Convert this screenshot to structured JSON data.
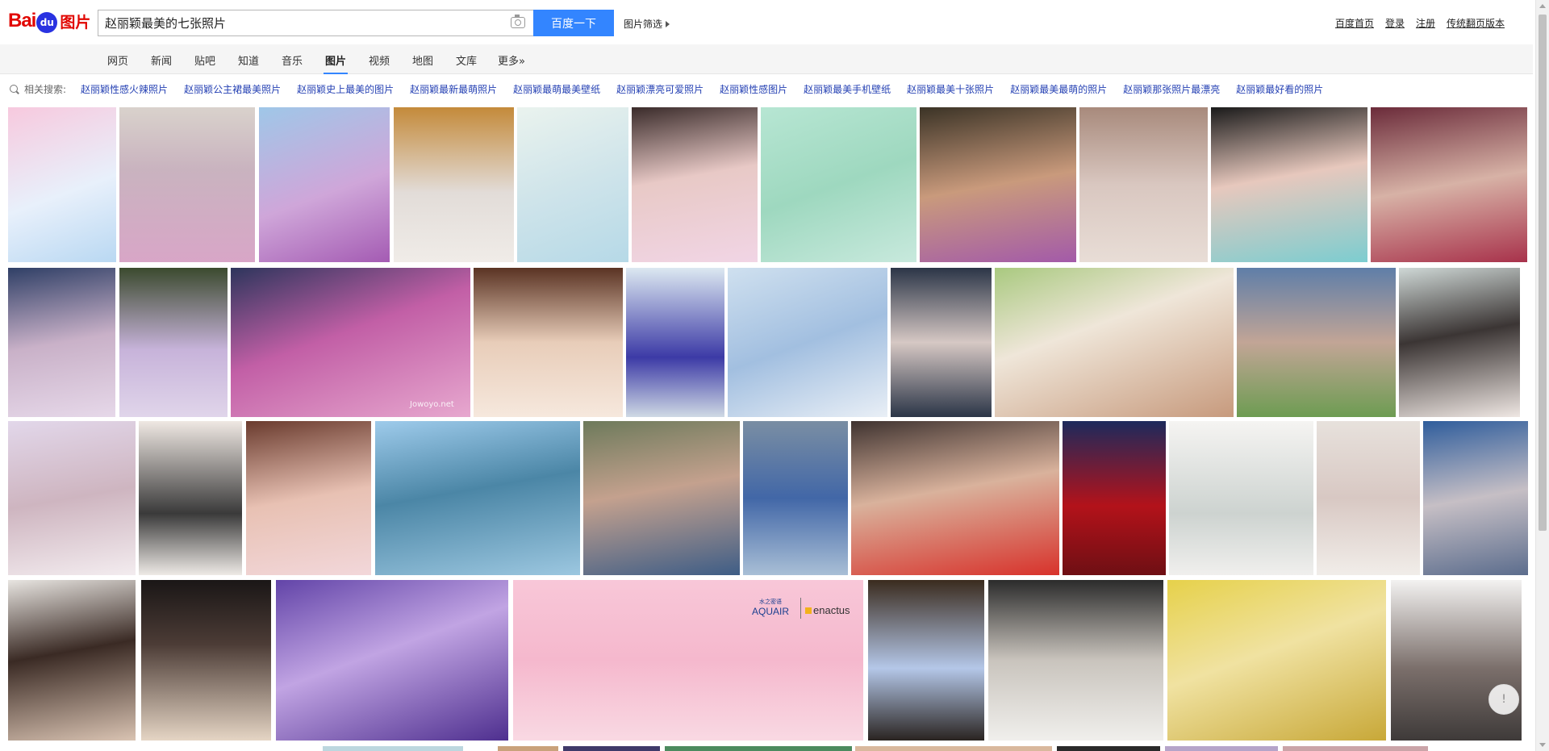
{
  "logo": {
    "bai": "Bai",
    "du": "du",
    "pic": "图片"
  },
  "search": {
    "query": "赵丽颖最美的七张照片",
    "button": "百度一下",
    "filter": "图片筛选"
  },
  "toplinks": [
    "百度首页",
    "登录",
    "注册",
    "传统翻页版本"
  ],
  "nav": {
    "items": [
      "网页",
      "新闻",
      "贴吧",
      "知道",
      "音乐",
      "图片",
      "视频",
      "地图",
      "文库",
      "更多»"
    ],
    "active": "图片"
  },
  "related": {
    "label": "相关搜索:",
    "items": [
      "赵丽颖性感火辣照片",
      "赵丽颖公主裙最美照片",
      "赵丽颖史上最美的图片",
      "赵丽颖最新最萌照片",
      "赵丽颖最萌最美壁纸",
      "赵丽颖漂亮可爱照片",
      "赵丽颖性感图片",
      "赵丽颖最美手机壁纸",
      "赵丽颖最美十张照片",
      "赵丽颖最美最萌的照片",
      "赵丽颖那张照片最漂亮",
      "赵丽颖最好看的照片"
    ]
  },
  "image_overlays": {
    "watermark": "Jowoyo.net",
    "ad_brand": "AQUAIR",
    "ad_brand_cn": "水之密语",
    "ad_partner": "enactus"
  },
  "colors": {
    "accent": "#3385ff",
    "link": "#2440b3",
    "logo_red": "#e10601",
    "logo_blue": "#2932e1"
  },
  "feedback_icon": "!"
}
